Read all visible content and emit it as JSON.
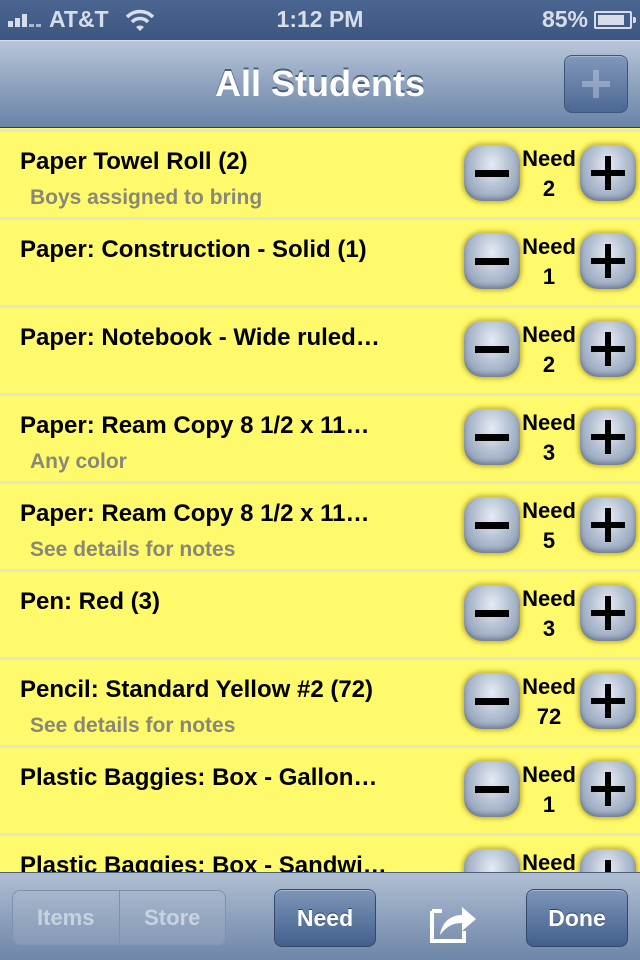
{
  "status_bar": {
    "carrier": "AT&T",
    "time": "1:12 PM",
    "battery_percent_label": "85%",
    "battery_level": 0.85,
    "signal_bars": 3,
    "icons": [
      "signal-icon",
      "wifi-icon",
      "battery-icon"
    ]
  },
  "nav_bar": {
    "title": "All Students",
    "add_button_icon": "plus-icon"
  },
  "list": {
    "need_label": "Need",
    "items": [
      {
        "title": "Paper Towel Roll (2)",
        "subtitle": "Boys assigned to bring",
        "need": "2"
      },
      {
        "title": "Paper: Construction - Solid (1)",
        "subtitle": "",
        "need": "1"
      },
      {
        "title": "Paper: Notebook - Wide ruled…",
        "subtitle": "",
        "need": "2"
      },
      {
        "title": "Paper: Ream Copy 8 1/2 x 11…",
        "subtitle": "Any color",
        "need": "3"
      },
      {
        "title": "Paper: Ream Copy 8 1/2 x 11…",
        "subtitle": "See details for notes",
        "need": "5"
      },
      {
        "title": "Pen: Red (3)",
        "subtitle": "",
        "need": "3"
      },
      {
        "title": "Pencil: Standard Yellow #2 (72)",
        "subtitle": "See details for notes",
        "need": "72"
      },
      {
        "title": "Plastic Baggies: Box - Gallon…",
        "subtitle": "",
        "need": "1"
      },
      {
        "title": "Plastic Baggies: Box - Sandwi…",
        "subtitle": "",
        "need": ""
      }
    ]
  },
  "toolbar": {
    "segments": [
      "Items",
      "Store"
    ],
    "need_button": "Need",
    "share_icon": "share-icon",
    "done_button": "Done"
  },
  "colors": {
    "row_background": "#fffa6b",
    "bar_blue": "#4c6895",
    "subtitle_gray": "#888878"
  }
}
